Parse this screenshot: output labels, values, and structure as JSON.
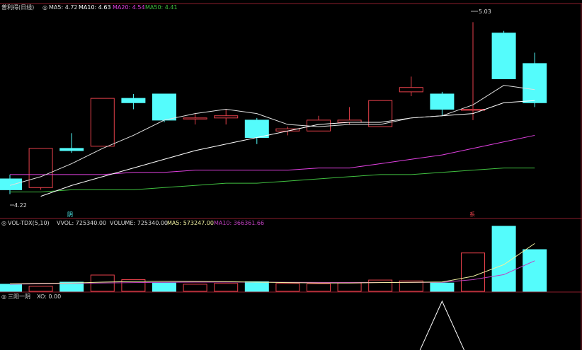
{
  "colors": {
    "background": "#000000",
    "up": "#e8414b",
    "down": "#54fcfc",
    "divider": "#8b1e2b",
    "grid": "#5a1a22",
    "ma5": "#e0e0e0",
    "ma10": "#ffffff",
    "ma20": "#e040e0",
    "ma50": "#40c040",
    "text": "#d8d8d8",
    "vol_ma5": "#f0f0a0",
    "vol_ma10": "#c040c0"
  },
  "header_top": {
    "title": "普利得(日线)",
    "ma5": "MA5: 4.72",
    "ma10": "MA10: 4.63",
    "ma20": "MA20: 4.54",
    "ma50": "MA50: 4.41"
  },
  "header_vol": {
    "title": "VOL-TDX(5,10)",
    "vvol": "VVOL: 725340.00",
    "volume": "VOLUME: 725340.00",
    "ma5": "MA5: 573247.00",
    "ma10": "MA10: 366361.66"
  },
  "header_ind": {
    "title": "三阳一阴",
    "xo": "XO: 0.00"
  },
  "markers": {
    "low": "4.22",
    "high": "5.03",
    "flag_left": "阴",
    "flag_right": "系"
  },
  "chart_data": [
    {
      "type": "candlestick",
      "name": "price",
      "ylim": [
        4.18,
        5.08
      ],
      "candles": [
        {
          "o": 4.31,
          "h": 4.33,
          "l": 4.24,
          "c": 4.26
        },
        {
          "o": 4.27,
          "h": 4.45,
          "l": 4.26,
          "c": 4.45
        },
        {
          "o": 4.45,
          "h": 4.52,
          "l": 4.43,
          "c": 4.44
        },
        {
          "o": 4.46,
          "h": 4.68,
          "l": 4.46,
          "c": 4.68
        },
        {
          "o": 4.68,
          "h": 4.7,
          "l": 4.63,
          "c": 4.66
        },
        {
          "o": 4.7,
          "h": 4.7,
          "l": 4.57,
          "c": 4.58
        },
        {
          "o": 4.59,
          "h": 4.61,
          "l": 4.56,
          "c": 4.59
        },
        {
          "o": 4.59,
          "h": 4.63,
          "l": 4.56,
          "c": 4.6
        },
        {
          "o": 4.58,
          "h": 4.59,
          "l": 4.47,
          "c": 4.5
        },
        {
          "o": 4.53,
          "h": 4.55,
          "l": 4.51,
          "c": 4.54
        },
        {
          "o": 4.53,
          "h": 4.6,
          "l": 4.53,
          "c": 4.58
        },
        {
          "o": 4.57,
          "h": 4.64,
          "l": 4.56,
          "c": 4.58
        },
        {
          "o": 4.55,
          "h": 4.67,
          "l": 4.55,
          "c": 4.67
        },
        {
          "o": 4.71,
          "h": 4.78,
          "l": 4.69,
          "c": 4.73
        },
        {
          "o": 4.7,
          "h": 4.71,
          "l": 4.6,
          "c": 4.63
        },
        {
          "o": 4.63,
          "h": 5.03,
          "l": 4.58,
          "c": 4.63
        },
        {
          "o": 4.98,
          "h": 4.99,
          "l": 4.77,
          "c": 4.77
        },
        {
          "o": 4.84,
          "h": 4.89,
          "l": 4.64,
          "c": 4.66
        }
      ],
      "ma5": [
        4.28,
        4.32,
        4.38,
        4.45,
        4.51,
        4.58,
        4.61,
        4.63,
        4.61,
        4.56,
        4.55,
        4.56,
        4.56,
        4.59,
        4.6,
        4.65,
        4.74,
        4.72
      ],
      "ma10": [
        null,
        4.23,
        4.28,
        4.32,
        4.36,
        4.4,
        4.44,
        4.47,
        4.5,
        4.53,
        4.56,
        4.57,
        4.57,
        4.59,
        4.6,
        4.61,
        4.66,
        4.67
      ],
      "ma20": [
        4.33,
        4.33,
        4.33,
        4.33,
        4.34,
        4.34,
        4.35,
        4.35,
        4.35,
        4.35,
        4.36,
        4.36,
        4.38,
        4.4,
        4.42,
        4.45,
        4.48,
        4.51
      ],
      "ma50": [
        4.25,
        4.25,
        4.26,
        4.26,
        4.26,
        4.27,
        4.28,
        4.29,
        4.29,
        4.3,
        4.31,
        4.32,
        4.33,
        4.33,
        4.34,
        4.35,
        4.36,
        4.36
      ]
    },
    {
      "type": "bar",
      "name": "volume",
      "ylim": [
        0,
        780000
      ],
      "values": [
        85000,
        60000,
        110000,
        195000,
        140000,
        100000,
        85000,
        95000,
        115000,
        95000,
        90000,
        100000,
        135000,
        125000,
        100000,
        460000,
        780000,
        500000
      ],
      "direction": [
        "down",
        "up",
        "down",
        "up",
        "up",
        "down",
        "up",
        "up",
        "down",
        "up",
        "up",
        "up",
        "up",
        "up",
        "down",
        "up",
        "down",
        "down"
      ],
      "ma5": [
        90000,
        95000,
        100000,
        110000,
        118000,
        120000,
        118000,
        115000,
        110000,
        105000,
        100000,
        100000,
        105000,
        108000,
        112000,
        180000,
        320000,
        573247
      ],
      "ma10": [
        85000,
        90000,
        95000,
        100000,
        105000,
        108000,
        110000,
        110000,
        110000,
        108000,
        107000,
        106000,
        106000,
        107000,
        108000,
        140000,
        200000,
        366361.66
      ]
    },
    {
      "type": "line",
      "name": "三阳一阴",
      "ylim": [
        0,
        1
      ],
      "values": [
        0,
        0,
        0,
        0,
        0,
        0,
        0,
        0,
        0,
        0,
        0,
        0,
        0,
        0,
        1,
        0,
        0,
        0
      ]
    }
  ]
}
